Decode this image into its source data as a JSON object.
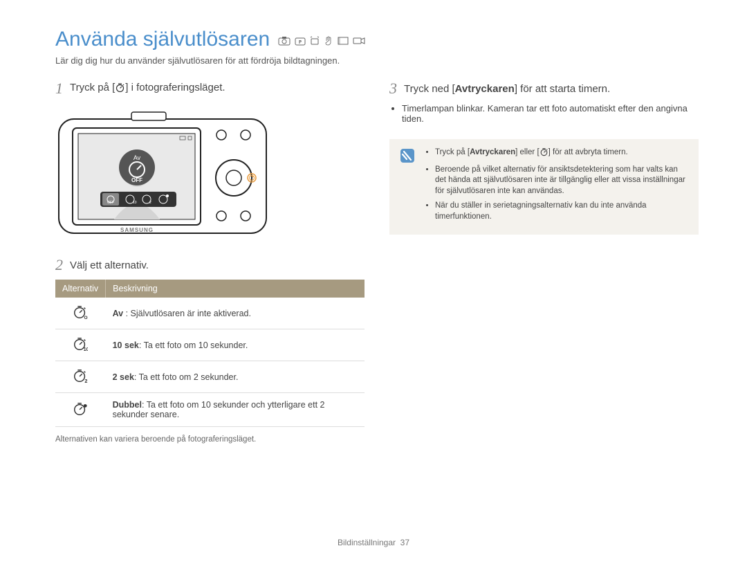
{
  "title": "Använda självutlösaren",
  "mode_icons": [
    "SMART",
    "P",
    "S",
    "DIS",
    "SCENE",
    "VIDEO"
  ],
  "subtitle": "Lär dig dig hur du använder självutlösaren för att fördröja bildtagningen.",
  "step1": {
    "num": "1",
    "text_before": "Tryck på [",
    "text_after": "] i fotograferingsläget."
  },
  "step2": {
    "num": "2",
    "text": "Välj ett alternativ."
  },
  "table": {
    "head_alt": "Alternativ",
    "head_desc": "Beskrivning",
    "rows": [
      {
        "icon": "off",
        "title": "Av",
        "desc": " : Självutlösaren är inte aktiverad."
      },
      {
        "icon": "10",
        "title": "10 sek",
        "desc": ": Ta ett foto om 10 sekunder."
      },
      {
        "icon": "2",
        "title": "2 sek",
        "desc": ": Ta ett foto om 2 sekunder."
      },
      {
        "icon": "double",
        "title": "Dubbel",
        "desc": ": Ta ett foto om 10 sekunder och ytterligare ett 2 sekunder senare."
      }
    ]
  },
  "note_small": "Alternativen kan variera beroende på fotograferingsläget.",
  "step3": {
    "num": "3",
    "text_before": "Tryck ned [",
    "shutter": "Avtryckaren",
    "text_after": "] för att starta timern.",
    "bullets": [
      "Timerlampan blinkar. Kameran tar ett foto automatiskt efter den angivna tiden."
    ]
  },
  "info_box": {
    "items": [
      {
        "pre": "Tryck på [",
        "bold1": "Avtryckaren",
        "mid": "] eller [",
        "bold2": "",
        "post": "] för att avbryta timern.",
        "has_icon": true
      },
      {
        "text": "Beroende på vilket alternativ för ansiktsdetektering som har valts kan det hända att självutlösaren inte är tillgänglig eller att vissa inställningar för självutlösaren inte kan användas."
      },
      {
        "text": "När du ställer in serietagningsalternativ kan du inte använda timerfunktionen."
      }
    ]
  },
  "footer": {
    "section": "Bildinställningar",
    "page": "37"
  },
  "camera_screen_label": "Av",
  "camera_screen_off": "OFF"
}
